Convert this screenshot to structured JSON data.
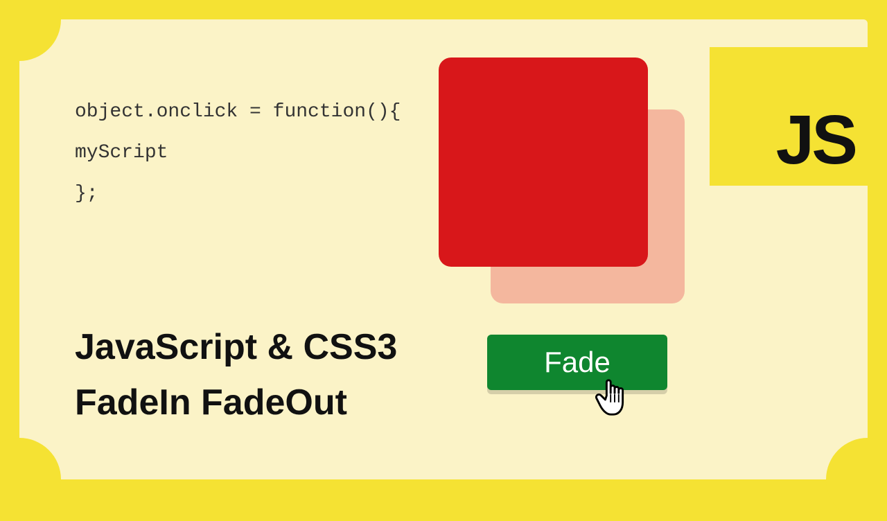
{
  "code": {
    "line1": "object.onclick = function(){",
    "line2": "myScript",
    "line3": "};"
  },
  "title": {
    "line1": "JavaScript & CSS3",
    "line2": "FadeIn FadeOut"
  },
  "badge": {
    "label": "JS"
  },
  "button": {
    "label": "Fade"
  },
  "colors": {
    "frame": "#f5e233",
    "panel": "#fbf3c7",
    "squareFront": "#d8171a",
    "squareBack": "#f4b79e",
    "button": "#0f862f"
  }
}
